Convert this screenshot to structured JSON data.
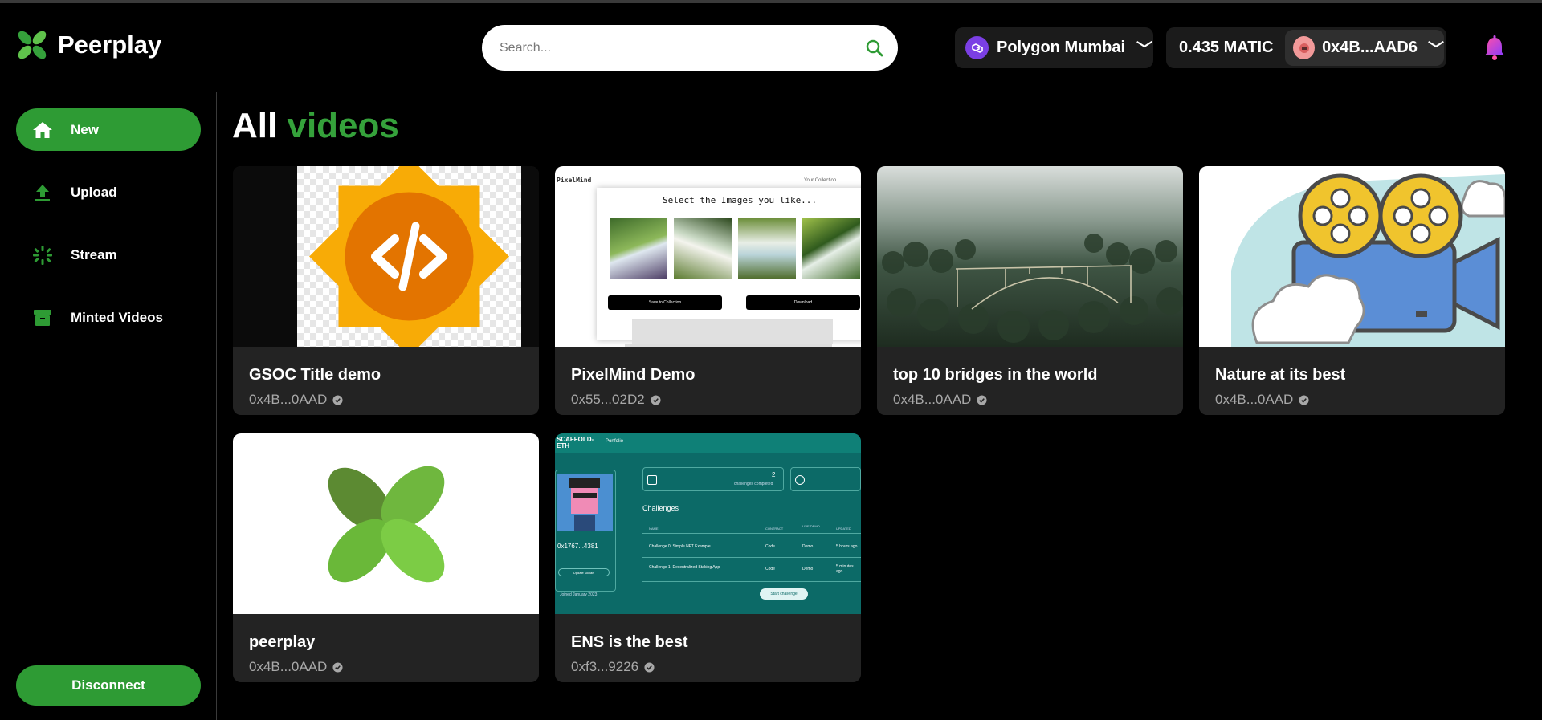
{
  "app": {
    "name": "Peerplay"
  },
  "header": {
    "search_placeholder": "Search...",
    "network_label": "Polygon Mumbai",
    "balance": "0.435 MATIC",
    "account": "0x4B...AAD6"
  },
  "sidebar": {
    "items": [
      {
        "label": "New",
        "icon": "home-icon",
        "active": true
      },
      {
        "label": "Upload",
        "icon": "upload-icon",
        "active": false
      },
      {
        "label": "Stream",
        "icon": "stream-icon",
        "active": false
      },
      {
        "label": "Minted Videos",
        "icon": "archive-icon",
        "active": false
      }
    ],
    "disconnect_label": "Disconnect"
  },
  "main": {
    "title_prefix": "All",
    "title_accent": "videos",
    "videos": [
      {
        "title": "GSOC Title demo",
        "owner": "0x4B...0AAD"
      },
      {
        "title": "PixelMind Demo",
        "owner": "0x55...02D2"
      },
      {
        "title": "top 10 bridges in the world",
        "owner": "0x4B...0AAD"
      },
      {
        "title": "Nature at its best",
        "owner": "0x4B...0AAD"
      },
      {
        "title": "peerplay",
        "owner": "0x4B...0AAD"
      },
      {
        "title": "ENS is the best",
        "owner": "0xf3...9226"
      }
    ],
    "thumbs": {
      "pixelmind": {
        "brand": "PixelMind",
        "nav": "Your Collection",
        "heading": "Select the Images you like...",
        "save_label": "Save to Collection",
        "download_label": "Download"
      },
      "ens": {
        "brand": "SCAFFOLD-ETH",
        "nav": "Portfolio",
        "address": "0x1767...4381",
        "update": "Update socials",
        "joined": "Joined January 2023",
        "count": "2",
        "completed": "challenges completed",
        "challenges_title": "Challenges",
        "col_name": "NAME",
        "col_type": "CONTRACT",
        "col_status": "LIVE DEMO",
        "col_updated": "UPDATED",
        "row1": "Challenge 0: Simple NFT Example",
        "row2": "Challenge 1: Decentralized Staking App",
        "cell_code": "Code",
        "cell_demo": "Demo",
        "row1_time": "5 hours ago",
        "row2_time": "5 minutes ago",
        "start_label": "Start challenge"
      }
    }
  },
  "colors": {
    "accent": "#2e9b34",
    "background": "#000000",
    "card": "#232323"
  }
}
